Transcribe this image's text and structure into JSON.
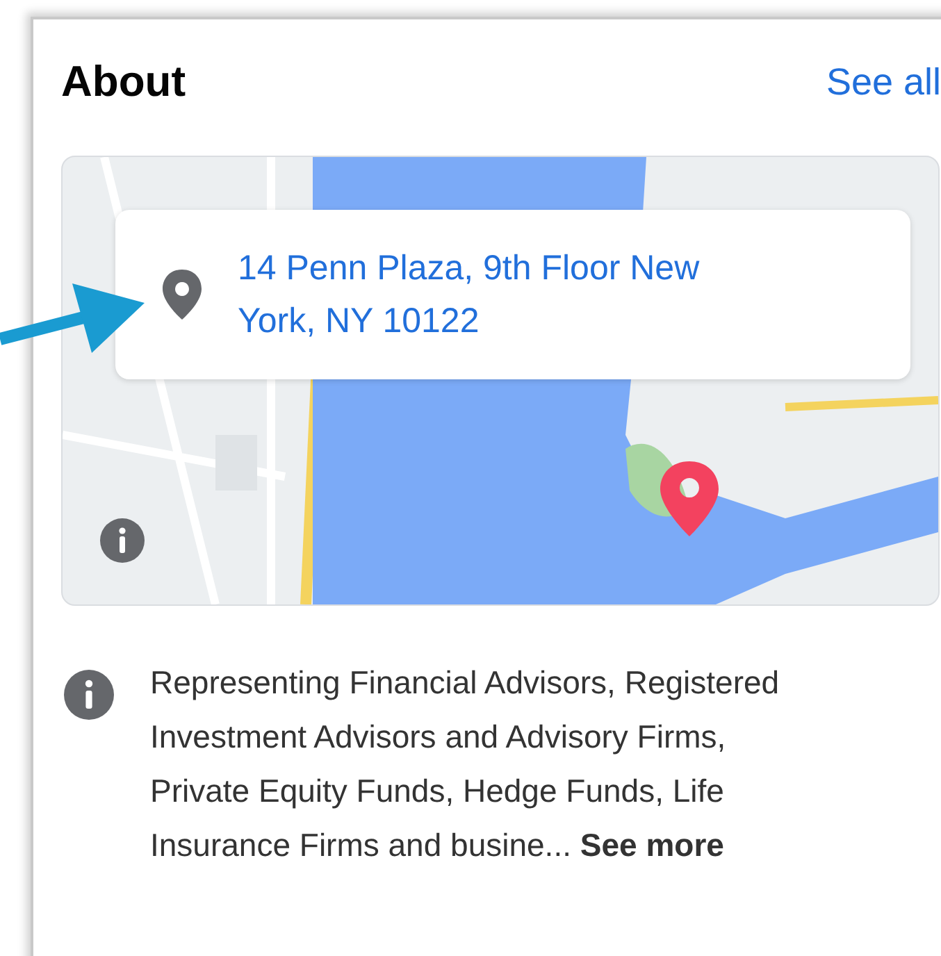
{
  "card": {
    "title": "About",
    "see_all": "See all"
  },
  "map": {
    "address": "14 Penn Plaza, 9th Floor New York, NY 10122"
  },
  "details": {
    "description": "Representing Financial Advisors, Registered Investment Advisors and Advisory Firms, Private Equity Funds, Hedge Funds, Life Insurance Firms and busine...",
    "see_more": "See more"
  }
}
